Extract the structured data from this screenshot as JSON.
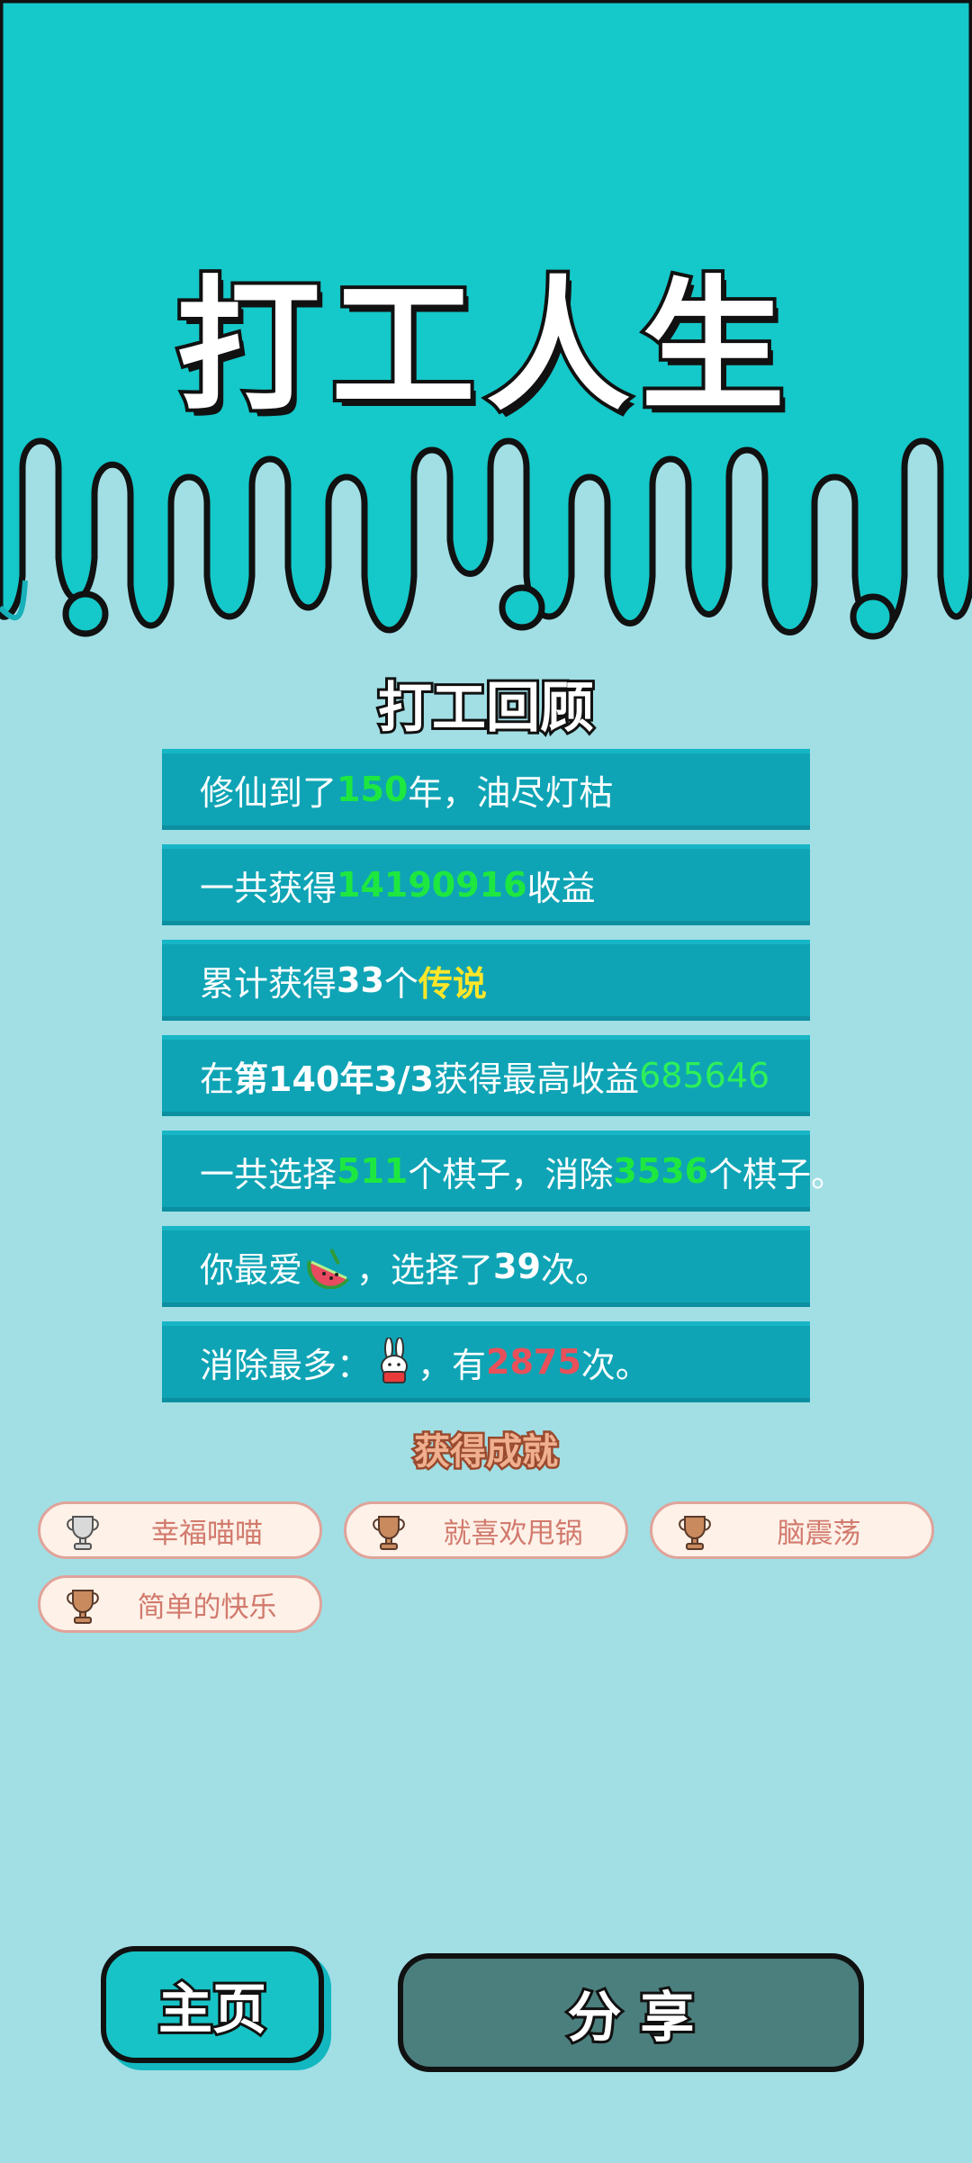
{
  "header": {
    "title": "打工人生"
  },
  "review": {
    "title": "打工回顾",
    "line1": {
      "a": "修仙到了",
      "v": "150",
      "b": "年，油尽灯枯"
    },
    "line2": {
      "a": "一共获得",
      "v": "14190916",
      "b": "收益"
    },
    "line3": {
      "a": "累计获得",
      "v": "33",
      "b": "个",
      "c": "传说"
    },
    "line4": {
      "a": "在 ",
      "v": "第140年3/3",
      "b": " 获得最高收益",
      "c": "685646"
    },
    "line5": {
      "a": "一共选择",
      "v": "511",
      "b": "个棋子，消除",
      "c": "3536",
      "d": "个棋子。"
    },
    "line6": {
      "a": "你最爱",
      "b": "，选择了",
      "v": "39",
      "c": "次。"
    },
    "line7": {
      "a": "消除最多：",
      "b": "，有",
      "v": "2875",
      "c": "次。"
    }
  },
  "achievements": {
    "title": "获得成就",
    "items": [
      {
        "label": "幸福喵喵",
        "trophy": "silver-trophy-icon"
      },
      {
        "label": "就喜欢甩锅",
        "trophy": "bronze-trophy-icon"
      },
      {
        "label": "脑震荡",
        "trophy": "bronze-trophy-icon"
      },
      {
        "label": "简单的快乐",
        "trophy": "bronze-trophy-icon"
      }
    ]
  },
  "buttons": {
    "home": "主页",
    "share": "分 享"
  },
  "colors": {
    "top_bg": "#15c8c9",
    "page_bg": "#a1dfe5",
    "stat_box": "#0fa4b5",
    "green": "#1ee840",
    "yellow": "#ffe629",
    "red": "#e8505a",
    "share_btn": "#4b7f7d",
    "home_btn": "#17c3c6"
  }
}
